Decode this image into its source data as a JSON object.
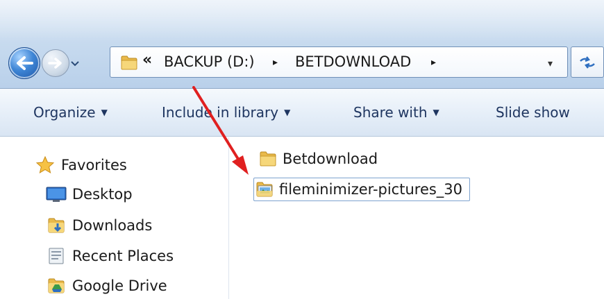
{
  "address": {
    "overflow_chevron": "«",
    "crumbs": [
      "BACKUP (D:)",
      "BETDOWNLOAD"
    ],
    "separator": "▸",
    "dropdown": "▾"
  },
  "toolbar": {
    "organize": "Organize",
    "include_in_library": "Include in library",
    "share_with": "Share with",
    "slide_show": "Slide show",
    "caret": "▼"
  },
  "navpane": {
    "items": [
      {
        "label": "Favorites",
        "icon": "star-icon"
      },
      {
        "label": "Desktop",
        "icon": "desktop-icon"
      },
      {
        "label": "Downloads",
        "icon": "downloads-folder-icon"
      },
      {
        "label": "Recent Places",
        "icon": "recent-places-icon"
      },
      {
        "label": "Google Drive",
        "icon": "google-drive-icon"
      }
    ]
  },
  "content": {
    "items": [
      {
        "label": "Betdownload",
        "icon": "folder-icon",
        "selected": false
      },
      {
        "label": "fileminimizer-pictures_30",
        "icon": "picture-folder-icon",
        "selected": true
      }
    ]
  },
  "colors": {
    "annotation_arrow": "#e02020",
    "toolbar_text": "#1e3560",
    "selection_border": "#7da2ce"
  }
}
